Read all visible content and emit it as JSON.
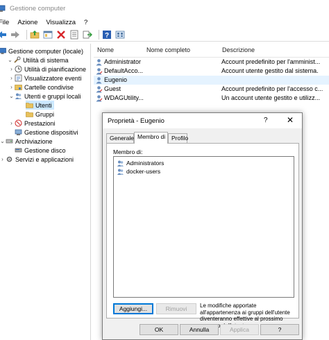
{
  "window": {
    "title": "Gestione computer"
  },
  "menu": [
    "File",
    "Azione",
    "Visualizza",
    "?"
  ],
  "tree": [
    {
      "label": "Gestione computer (locale)",
      "icon": "computer-management-icon",
      "level": 0,
      "arrow": ""
    },
    {
      "label": "Utilità di sistema",
      "icon": "tools-icon",
      "level": 1,
      "arrow": "⌄"
    },
    {
      "label": "Utilità di pianificazione",
      "icon": "clock-icon",
      "level": 2,
      "arrow": "›"
    },
    {
      "label": "Visualizzatore eventi",
      "icon": "event-viewer-icon",
      "level": 2,
      "arrow": "›"
    },
    {
      "label": "Cartelle condivise",
      "icon": "shared-folder-icon",
      "level": 2,
      "arrow": "›"
    },
    {
      "label": "Utenti e gruppi locali",
      "icon": "users-icon",
      "level": 2,
      "arrow": "⌄"
    },
    {
      "label": "Utenti",
      "icon": "folder-icon",
      "level": 3,
      "arrow": "",
      "selected": true
    },
    {
      "label": "Gruppi",
      "icon": "folder-icon",
      "level": 3,
      "arrow": ""
    },
    {
      "label": "Prestazioni",
      "icon": "performance-icon",
      "level": 2,
      "arrow": "›"
    },
    {
      "label": "Gestione dispositivi",
      "icon": "device-manager-icon",
      "level": 2,
      "arrow": ""
    },
    {
      "label": "Archiviazione",
      "icon": "storage-icon",
      "level": 1,
      "arrow": "⌄"
    },
    {
      "label": "Gestione disco",
      "icon": "disk-icon",
      "level": 2,
      "arrow": ""
    },
    {
      "label": "Servizi e applicazioni",
      "icon": "services-icon",
      "level": 1,
      "arrow": "›"
    }
  ],
  "list": {
    "headers": [
      "Nome",
      "Nome completo",
      "Descrizione"
    ],
    "rows": [
      {
        "name": "Administrator",
        "fullname": "",
        "description": "Account predefinito per l'amminist..."
      },
      {
        "name": "DefaultAcco...",
        "fullname": "",
        "description": "Account utente gestito dal sistema."
      },
      {
        "name": "Eugenio",
        "fullname": "",
        "description": "",
        "selected": true
      },
      {
        "name": "Guest",
        "fullname": "",
        "description": "Account predefinito per l'accesso c..."
      },
      {
        "name": "WDAGUtility...",
        "fullname": "",
        "description": "Un account utente gestito e utilizz..."
      }
    ]
  },
  "dialog": {
    "title": "Proprietà - Eugenio",
    "help": "?",
    "close": "✕",
    "tabs": [
      "Generale",
      "Membro di",
      "Profilo"
    ],
    "member_of_label": "Membro di:",
    "members": [
      "Administrators",
      "docker-users"
    ],
    "add_button": "Aggiungi...",
    "remove_button": "Rimuovi",
    "note": "Le modifiche apportate all'appartenenza ai gruppi dell'utente diventeranno effettive al prossimo accesso dell'utente.",
    "ok_button": "OK",
    "cancel_button": "Annulla",
    "apply_button": "Applica",
    "help_button": "?"
  }
}
